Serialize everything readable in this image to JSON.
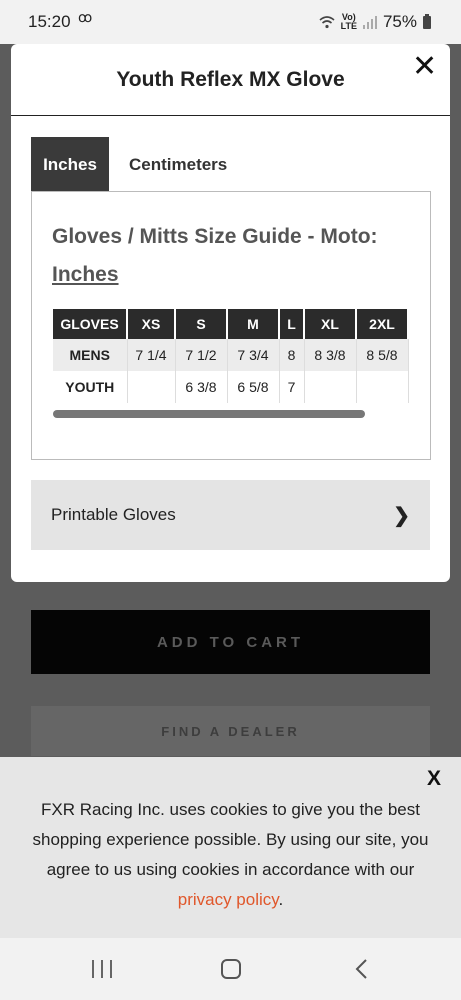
{
  "status_bar": {
    "time": "15:20",
    "voicemail_icon": "voicemail-icon",
    "network": "Vo)\nLTE",
    "battery": "75%"
  },
  "background": {
    "add_to_cart": "ADD TO CART",
    "find_dealer": "FIND A DEALER"
  },
  "modal": {
    "title": "Youth Reflex MX Glove",
    "close_icon": "close-icon",
    "tabs": [
      {
        "label": "Inches",
        "active": true
      },
      {
        "label": "Centimeters",
        "active": false
      }
    ],
    "guide_title": "Gloves / Mitts Size Guide - Moto:",
    "guide_unit": "Inches",
    "table": {
      "headers": [
        "GLOVES",
        "XS",
        "S",
        "M",
        "L",
        "XL",
        "2XL"
      ],
      "rows": [
        [
          "MENS",
          "7 1/4",
          "7 1/2",
          "7 3/4",
          "8",
          "8 3/8",
          "8 5/8"
        ],
        [
          "YOUTH",
          "",
          "6 3/8",
          "6 5/8",
          "7",
          "",
          ""
        ]
      ]
    },
    "printable_label": "Printable Gloves",
    "printable_chevron": "❯"
  },
  "cookie": {
    "close": "X",
    "text": "FXR Racing Inc. uses cookies to give you the best shopping experience possible. By using our site, you agree to us using cookies in accordance with our ",
    "link": "privacy policy",
    "end": "."
  }
}
